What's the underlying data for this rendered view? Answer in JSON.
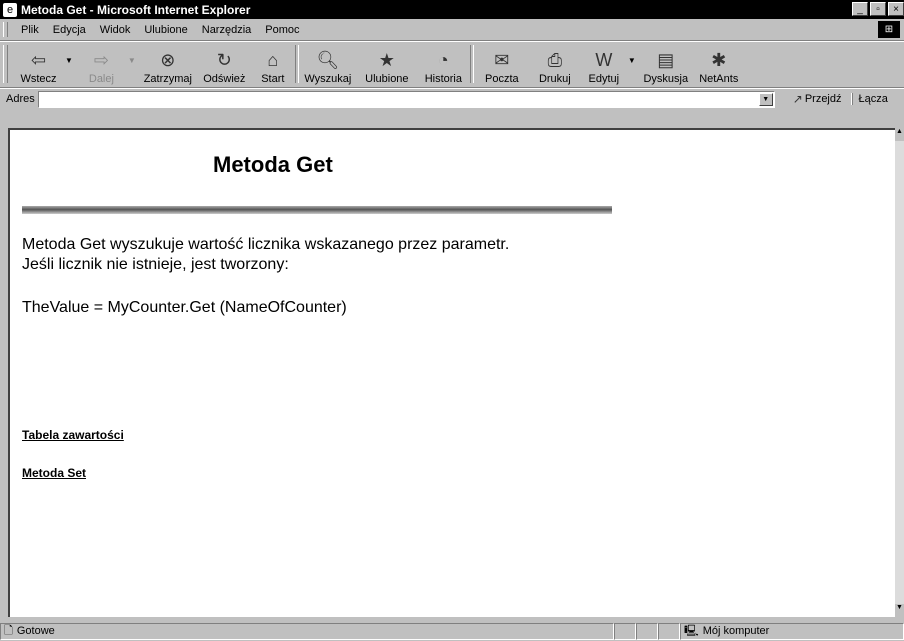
{
  "window": {
    "title": "Metoda Get - Microsoft Internet Explorer"
  },
  "menu": [
    "Plik",
    "Edycja",
    "Widok",
    "Ulubione",
    "Narzędzia",
    "Pomoc"
  ],
  "toolbar": {
    "back": "Wstecz",
    "forward": "Dalej",
    "stop": "Zatrzymaj",
    "refresh": "Odśwież",
    "home": "Start",
    "search": "Wyszukaj",
    "favorites": "Ulubione",
    "history": "Historia",
    "mail": "Poczta",
    "print": "Drukuj",
    "edit": "Edytuj",
    "discuss": "Dyskusja",
    "netants": "NetAnts"
  },
  "address": {
    "label": "Adres",
    "value": "",
    "go": "Przejdź",
    "links": "Łącza"
  },
  "page": {
    "title": "Metoda Get",
    "line1": "Metoda Get wyszukuje wartość licznika wskazanego przez parametr.",
    "line2": "Jeśli licznik nie istnieje, jest tworzony:",
    "code": "TheValue = MyCounter.Get (NameOfCounter)",
    "link_toc": "Tabela zawartości",
    "link_set": "Metoda Set"
  },
  "status": {
    "text": "Gotowe",
    "zone": "Mój komputer"
  }
}
